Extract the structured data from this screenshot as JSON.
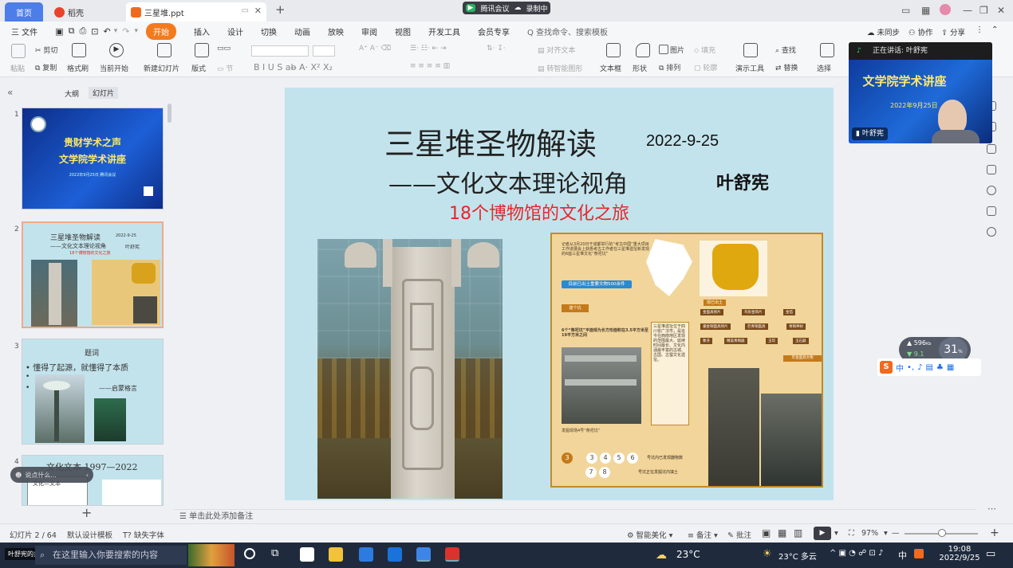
{
  "tabs": {
    "home": "首页",
    "straw": "稻壳",
    "doc": "三星堆.ppt"
  },
  "meeting": {
    "app": "腾讯会议",
    "status": "录制中"
  },
  "menu": [
    "三 文件",
    "开始",
    "插入",
    "设计",
    "切换",
    "动画",
    "放映",
    "审阅",
    "视图",
    "开发工具",
    "会员专享"
  ],
  "menu_active": "开始",
  "search": {
    "placeholder": "Q 查找命令、搜索模板"
  },
  "top_right": {
    "sync": "未同步",
    "collab": "协作",
    "share": "分享"
  },
  "ribbon": {
    "paste": "粘贴",
    "cut": "剪切",
    "copy": "复制",
    "format_painter": "格式刷",
    "start_from_current": "当前开始",
    "new_slide": "新建幻灯片",
    "layout": "版式",
    "section": "节",
    "align_text": "对齐文本",
    "convert_smartart": "转智能图形",
    "textbox": "文本框",
    "shape": "形状",
    "picture": "图片",
    "arrange": "排列",
    "fill": "填充",
    "outline": "轮廓",
    "presenter_tools": "演示工具",
    "find": "查找",
    "replace": "替换",
    "select": "选择"
  },
  "left_panel": {
    "tab_outline": "大纲",
    "tab_slides": "幻灯片",
    "slides": [
      {
        "num": "1",
        "title": "贵财学术之声",
        "subtitle": "文学院学术讲座",
        "date": "2022年9月25日 腾讯会议"
      },
      {
        "num": "2",
        "title": "三星堆圣物解读",
        "date": "2022-9-25",
        "subtitle": "——文化文本理论视角",
        "author": "叶舒宪",
        "tagline": "18个博物馆的文化之旅"
      },
      {
        "num": "3",
        "title": "题词",
        "line1": "• 懂得了起源，就懂得了本质",
        "quote": "——启蒙格言"
      },
      {
        "num": "4",
        "title": "文化文本 1997—2022",
        "sub": "文化—文本"
      }
    ],
    "add": "+"
  },
  "slide": {
    "title": "三星堆圣物解读",
    "date": "2022-9-25",
    "subtitle": "——文化文本理论视角",
    "author": "叶舒宪",
    "tagline": "18个博物馆的文化之旅",
    "collage": {
      "intro": "记者从3月20日于成都举行的“考古中国”重大项目工作进展会上获悉考古工作者在三星堆遗址新发现的6座三星堆文化“祭祀坑”",
      "highlight": "目前已出土重要文物500余件",
      "section1": "建个坑",
      "pits": "6个“祭祀坑”平面现为长方形面积在3.5平方米至19平方米之间",
      "side": "三星堆遗址位于四川省广汉市，是迄今在西南地区发现的范围最大、延续时间最长、文化内涵最丰富的古城、古国、古蜀文化遗址。",
      "numbers": [
        "3",
        "4",
        "5",
        "6"
      ],
      "numbers2": [
        "7",
        "8"
      ],
      "n1": "号坑内已发现器物数",
      "n2": "号坑正在发掘坑内填土",
      "section2": "现已出土",
      "items": [
        "金面具残片",
        "鸟形金饰片",
        "金箔",
        "鎏金铜面具残片",
        "巨青铜面具",
        "青铜神树",
        "象牙",
        "精美青铜器",
        "玉琮",
        "玉石器"
      ],
      "section3": "年金面具文物",
      "photo_caption": "发掘现场4号“祭祀坑”"
    }
  },
  "video": {
    "title": "文学院学术讲座",
    "speaking": "正在讲话: 叶舒宪",
    "name": "叶舒宪",
    "date_fragment": "2022年9月25日"
  },
  "notes": "单击此处添加备注",
  "status": {
    "slide_count": "幻灯片 2 / 64",
    "template": "默认设计模板",
    "font_missing": "缺失字体",
    "smart_beautify": "智能美化",
    "notes_btn": "备注",
    "comment": "批注",
    "zoom": "97%"
  },
  "perf": {
    "up": "596",
    "down": "9.1",
    "cpu": "31"
  },
  "ime": {
    "lang": "中"
  },
  "share_label": "叶舒宪的共享屏幕",
  "ppt_voice": "说点什么...",
  "taskbar": {
    "search": "在这里输入你要搜索的内容",
    "weather1": "23°C",
    "weather2": "23°C 多云",
    "lang": "中",
    "time": "19:08",
    "date": "2022/9/25"
  },
  "colors": {
    "accent_orange": "#f37b1f",
    "slide_bg": "#c3e3ec",
    "tagline_red": "#e8262b",
    "home_tab": "#4c7de8",
    "thumb1_bg": "#1848b0"
  }
}
